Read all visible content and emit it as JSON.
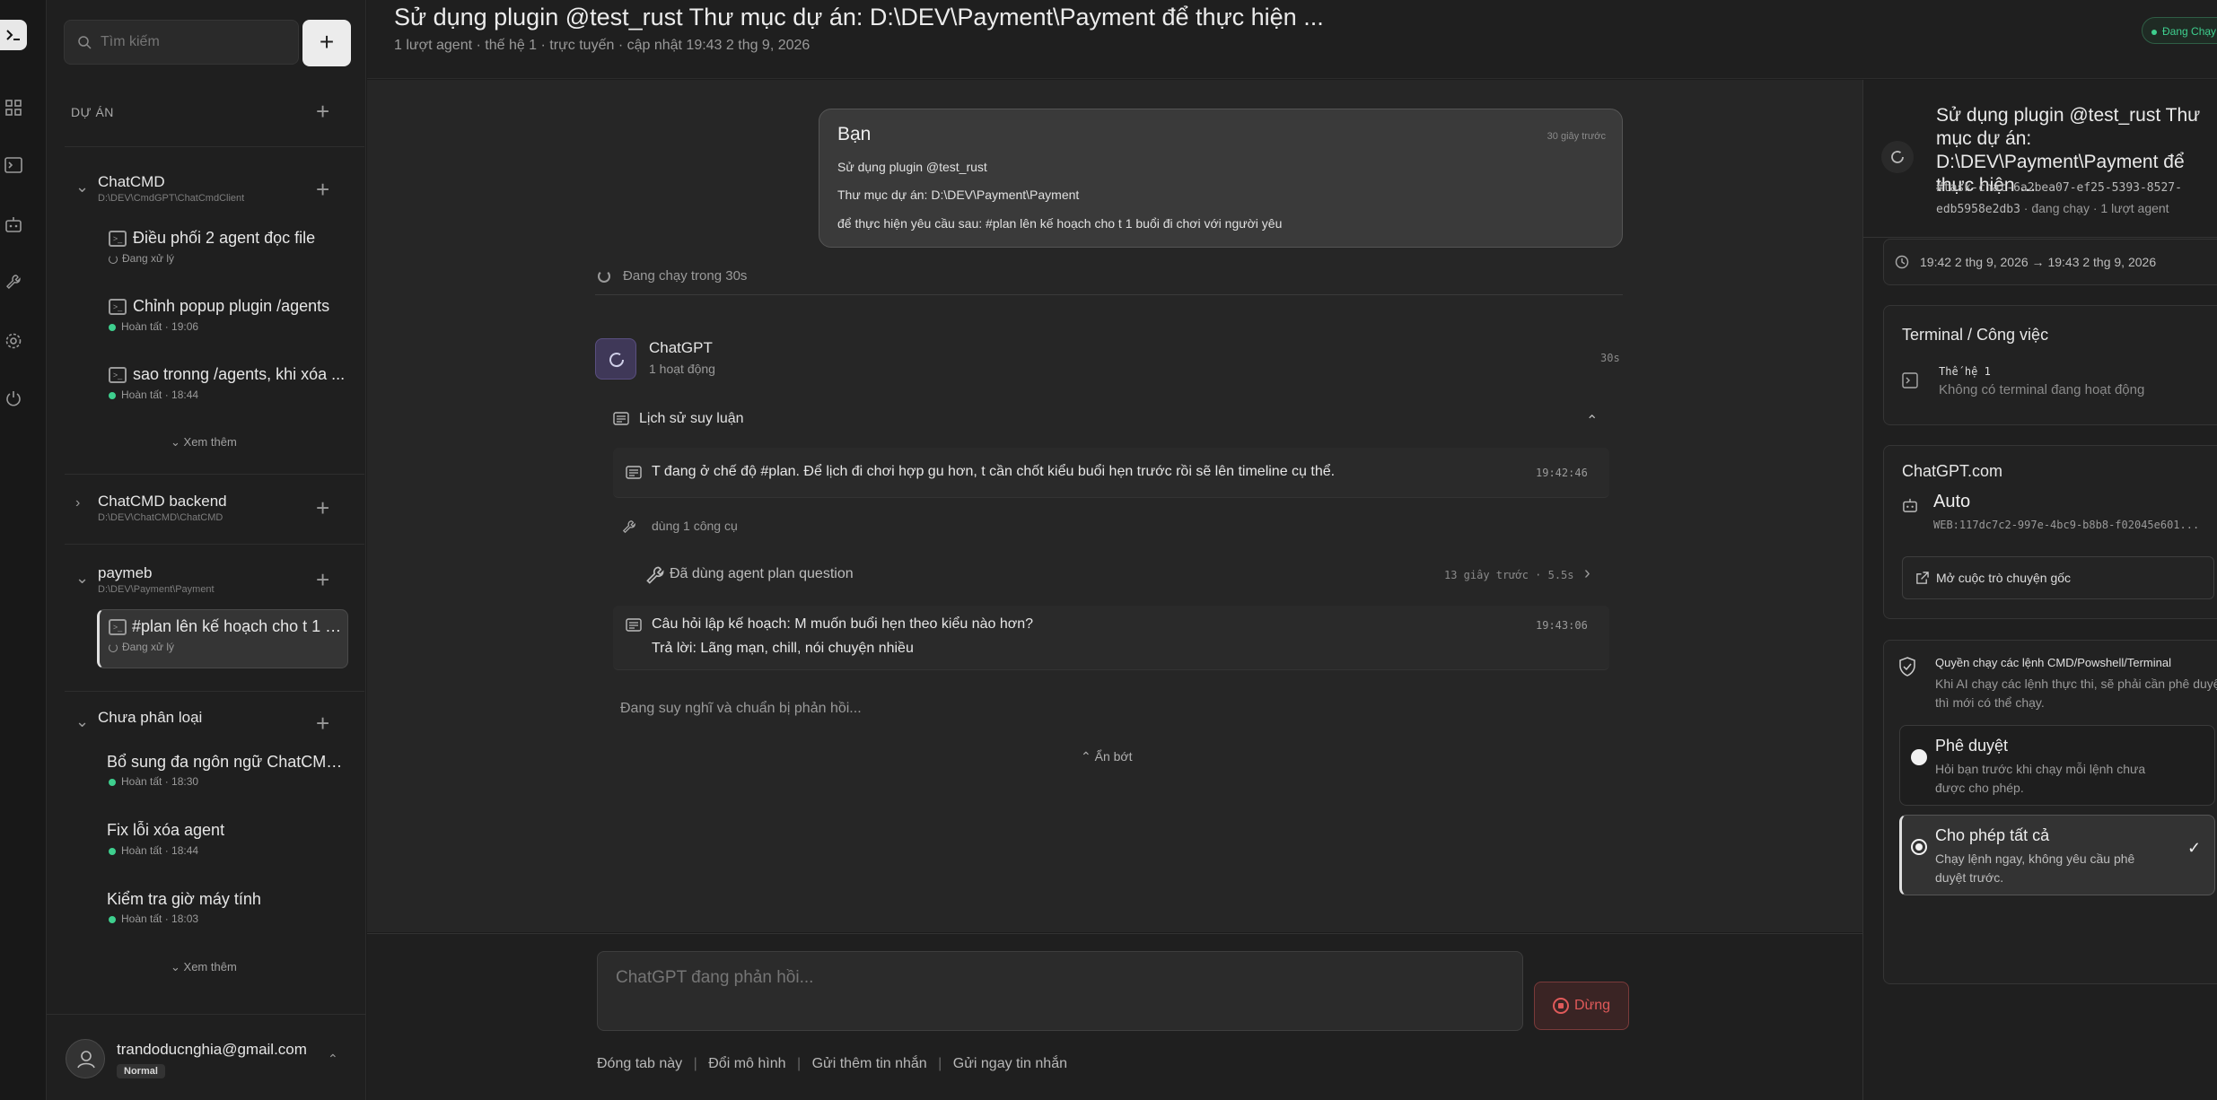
{
  "sidebar": {
    "search_placeholder": "Tìm kiếm",
    "projects_heading": "DỰ ÁN",
    "projects": [
      {
        "name": "ChatCMD",
        "path": "D:\\DEV\\CmdGPT\\ChatCmdClient",
        "chats": [
          {
            "title": "Điều phối 2 agent đọc file",
            "status": "Đang xử lý"
          },
          {
            "title": "Chỉnh popup plugin /agents",
            "status": "Hoàn tất · 19:06"
          },
          {
            "title": "sao tronng /agents, khi xóa ...",
            "status": "Hoàn tất · 18:44"
          }
        ],
        "more": "Xem thêm"
      },
      {
        "name": "ChatCMD backend",
        "path": "D:\\DEV\\ChatCMD\\ChatCMD"
      },
      {
        "name": "paymeb",
        "path": "D:\\DEV\\Payment\\Payment",
        "chats": [
          {
            "title": "#plan lên kế hoạch cho t 1 b...",
            "status": "Đang xử lý"
          }
        ]
      },
      {
        "name": "Chưa phân loại",
        "chats": [
          {
            "title": "Bổ sung đa ngôn ngữ ChatCMD...",
            "status": "Hoàn tất · 18:30"
          },
          {
            "title": "Fix lỗi xóa agent",
            "status": "Hoàn tất · 18:44"
          },
          {
            "title": "Kiểm tra giờ máy tính",
            "status": "Hoàn tất · 18:03"
          }
        ],
        "more": "Xem thêm"
      }
    ],
    "user": {
      "email": "trandoducnghia@gmail.com",
      "badge": "Normal"
    }
  },
  "header": {
    "title": "Sử dụng plugin @test_rust Thư mục dự án: D:\\DEV\\Payment\\Payment để thực hiện ...",
    "meta": "1 lượt agent · thế hệ 1 · trực tuyến · cập nhật 19:43 2 thg 9, 2026",
    "status_badge": "Đang Chạy"
  },
  "conversation": {
    "user_message": {
      "sender": "Bạn",
      "time": "30 giây trước",
      "lines": [
        "Sử dụng plugin @test_rust",
        "Thư mục dự án: D:\\DEV\\Payment\\Payment",
        "để thực hiện yêu cầu sau: #plan lên kế hoạch cho t 1 buổi đi chơi với người yêu"
      ]
    },
    "running": "Đang chạy trong 30s",
    "agent": {
      "name": "ChatGPT",
      "activity": "1 hoạt động",
      "elapsed": "30s"
    },
    "reasoning_title": "Lịch sử suy luận",
    "step1": {
      "text": "T đang ở chế độ #plan. Để lịch đi chơi hợp gu hơn, t cần chốt kiểu buổi hẹn trước rồi sẽ lên timeline cụ thể.",
      "time": "19:42:46"
    },
    "tools_used": "dùng 1 công cụ",
    "tool_call": {
      "text": "Đã dùng agent plan question",
      "meta": "13 giây trước · 5.5s"
    },
    "step2": {
      "question": "Câu hỏi lập kế hoạch: M muốn buổi hẹn theo kiểu nào hơn?",
      "answer": "Trả lời: Lãng mạn, chill, nói chuyện nhiều",
      "time": "19:43:06"
    },
    "thinking": "Đang suy nghĩ và chuẩn bị phản hồi...",
    "collapse": "Ẩn bớt"
  },
  "composer": {
    "placeholder": "ChatGPT đang phản hồi...",
    "stop": "Dừng",
    "actions": [
      "Đóng tab này",
      "Đổi mô hình",
      "Gửi thêm tin nhắn",
      "Gửi ngay tin nhắn"
    ]
  },
  "right_panel": {
    "title": "Sử dụng plugin @test_rust Thư mục dự án: D:\\DEV\\Payment\\Payment để thực hiện ...",
    "task_id": "#task-chat-6a2bea07-ef25-5393-8527-edb5958e2db3",
    "task_meta": " · đang chạy · 1 lượt agent",
    "time_range": "19:42 2 thg 9, 2026 → 19:43 2 thg 9, 2026",
    "terminal": {
      "heading": "Terminal / Công việc",
      "gen": "Thế hệ 1",
      "empty": "Không có terminal đang hoạt động"
    },
    "chatgpt": {
      "heading": "ChatGPT.com",
      "model": "Auto",
      "web_id": "WEB:117dc7c2-997e-4bc9-b8b8-f02045e601...",
      "open_original": "Mở cuộc trò chuyện gốc"
    },
    "permission": {
      "heading": "Quyền chạy các lệnh CMD/Powshell/Terminal",
      "desc": "Khi AI chạy các lệnh thực thi, sẽ phải cần phê duyệt thì mới có thể chạy.",
      "options": [
        {
          "title": "Phê duyệt",
          "desc": "Hỏi bạn trước khi chạy mỗi lệnh chưa được cho phép.",
          "selected": false
        },
        {
          "title": "Cho phép tất cả",
          "desc": "Chạy lệnh ngay, không yêu cầu phê duyệt trước.",
          "selected": true
        }
      ]
    }
  }
}
